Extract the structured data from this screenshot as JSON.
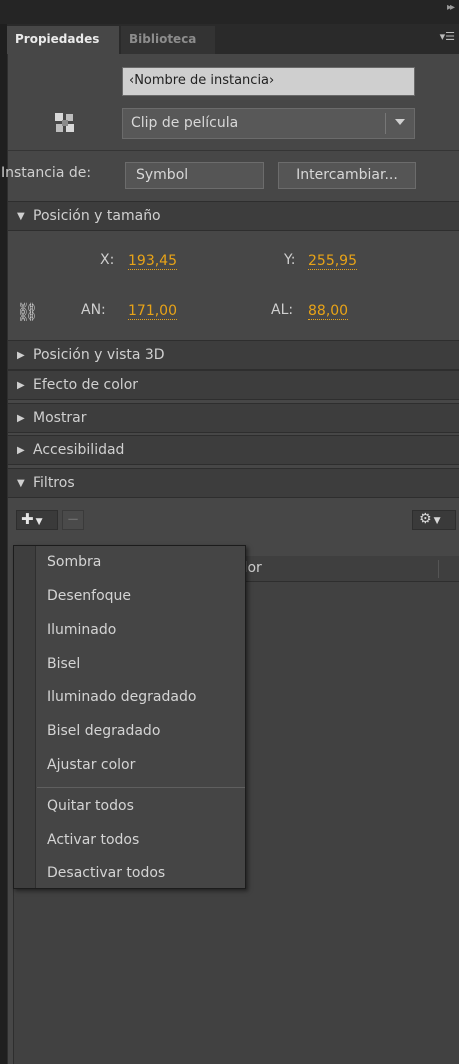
{
  "tabs": [
    {
      "label": "Propiedades",
      "active": true
    },
    {
      "label": "Biblioteca",
      "active": false
    }
  ],
  "instance": {
    "name_placeholder": "‹Nombre de instancia›",
    "type_value": "Clip de película",
    "label": "Instancia de:",
    "symbol": "Symbol",
    "swap_label": "Intercambiar..."
  },
  "sections": {
    "position_size": "Posición y tamaño",
    "position_3d": "Posición y vista 3D",
    "color_effect": "Efecto de color",
    "display": "Mostrar",
    "accessibility": "Accesibilidad",
    "filters": "Filtros"
  },
  "position": {
    "x_label": "X:",
    "x_value": "193,45",
    "y_label": "Y:",
    "y_value": "255,95",
    "w_label": "AN:",
    "w_value": "171,00",
    "h_label": "AL:",
    "h_value": "88,00"
  },
  "filters_table": {
    "value_column": "alor"
  },
  "filter_menu": {
    "items": [
      "Sombra",
      "Desenfoque",
      "Iluminado",
      "Bisel",
      "Iluminado degradado",
      "Bisel degradado",
      "Ajustar color"
    ],
    "actions": [
      "Quitar todos",
      "Activar todos",
      "Desactivar todos"
    ]
  },
  "colors": {
    "panel_bg": "#474747",
    "value_accent": "#e8a317",
    "input_bg": "#cfcfcf"
  }
}
